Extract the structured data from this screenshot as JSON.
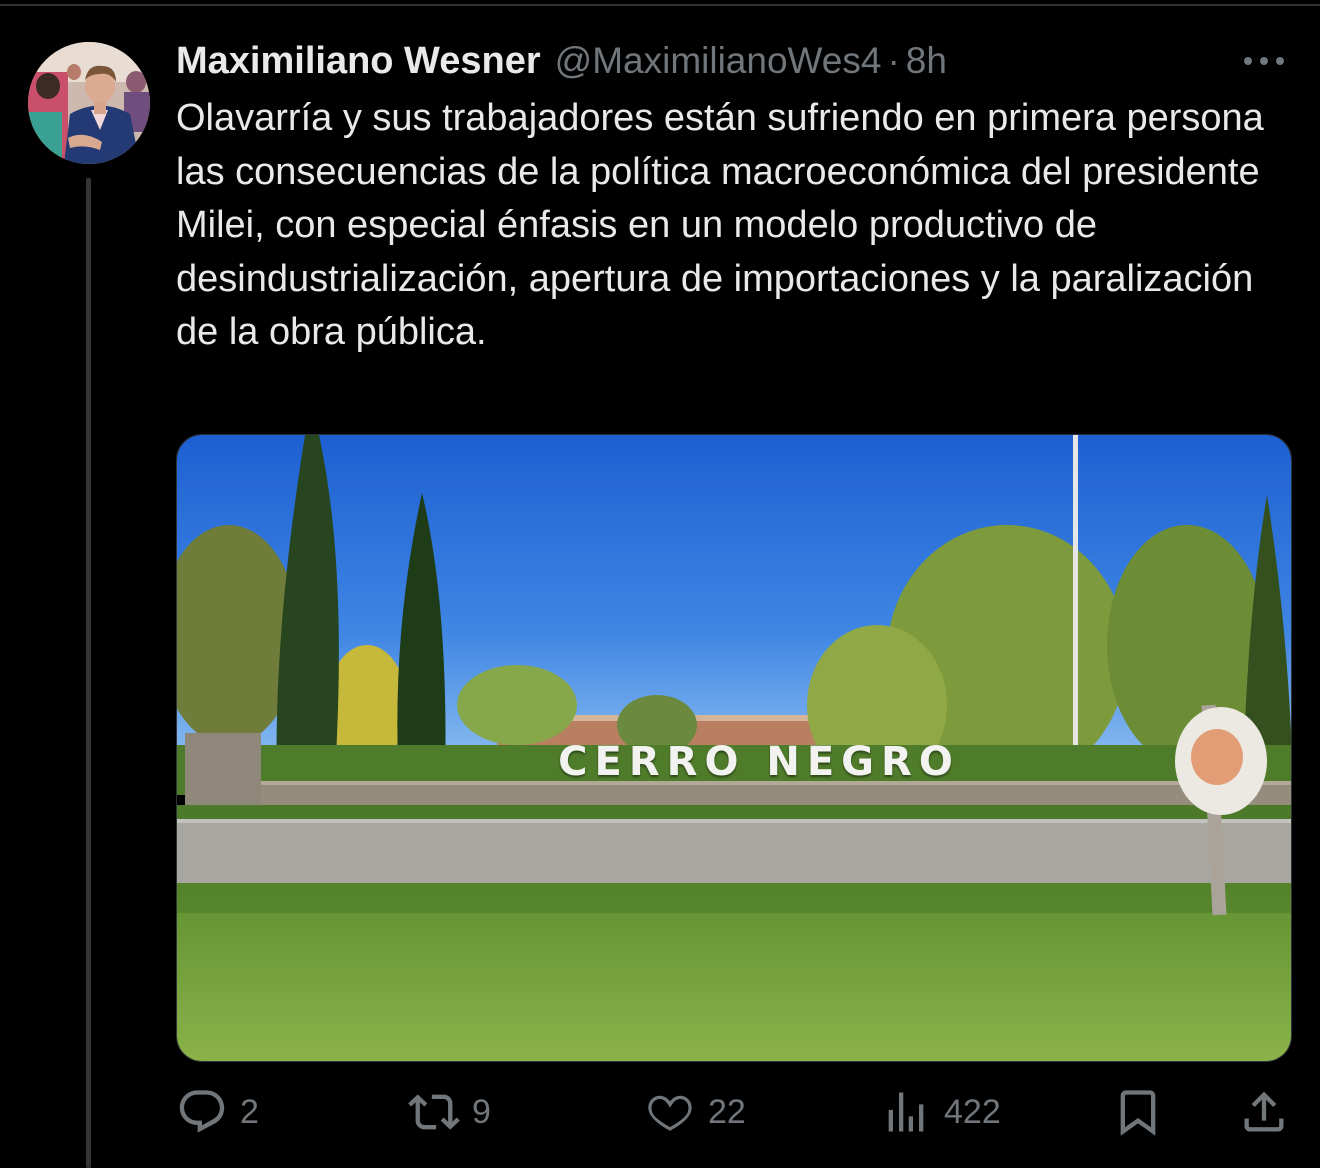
{
  "tweet": {
    "author_name": "Maximiliano Wesner",
    "handle": "@MaximilianoWes4",
    "separator": "·",
    "time": "8h",
    "text": "Olavarría y sus trabajadores están sufriendo en primera persona las consecuencias de la política macroeconómica del presidente Milei, con especial énfasis en un modelo productivo de desindustrialización, apertura de importaciones y la paralización de la obra pública."
  },
  "media": {
    "sign_text": "CERRO NEGRO",
    "icon": "photo"
  },
  "actions": {
    "replies": "2",
    "reposts": "9",
    "likes": "22",
    "views": "422"
  },
  "icons": {
    "more": "more-horizontal-icon",
    "reply": "reply-icon",
    "repost": "repost-icon",
    "like": "heart-icon",
    "views": "views-icon",
    "bookmark": "bookmark-icon",
    "share": "share-icon"
  },
  "colors": {
    "background": "#000000",
    "text_primary": "#e7e9ea",
    "text_secondary": "#71767b",
    "divider": "#2f3336"
  }
}
